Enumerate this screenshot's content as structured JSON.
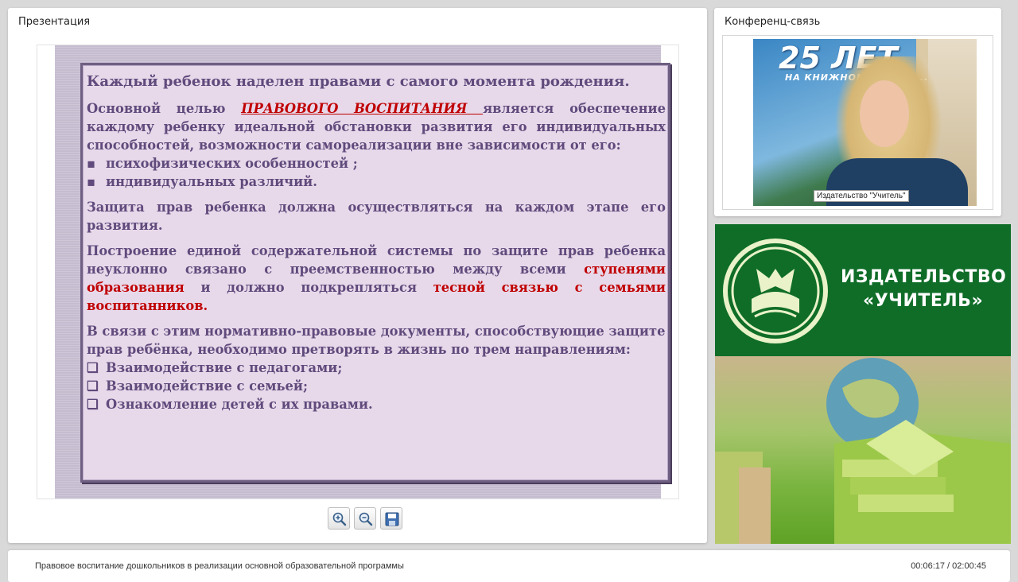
{
  "presentation": {
    "title": "Презентация",
    "slide": {
      "p1": "Каждый ребенок наделен правами с самого момента рождения.",
      "p2_before": "Основной целью ",
      "p2_highlight": "ПРАВОВОГО ВОСПИТАНИЯ ",
      "p2_after": " является обеспечение каждому ребенку идеальной обстановки развития его индивидуальных способностей, возможности самореализации вне зависимости от его:",
      "bullet_marker": "▪",
      "bullets": [
        "психофизических особенностей ;",
        "индивидуальных различий."
      ],
      "p3": "Защита прав ребенка должна осуществляться на каждом этапе его развития.",
      "p4_a": "Построение единой содержательной системы по защите прав ребенка неуклонно связано с преемственностью между всеми ",
      "p4_b": "ступенями образования",
      "p4_c": " и должно подкрепляться ",
      "p4_d": "тесной связью с семьями воспитанников.",
      "p5": "В связи с этим нормативно-правовые документы, способствующие защите прав ребёнка, необходимо претворять в жизнь по трем направлениям:",
      "check_marker": "❑",
      "checks": [
        "Взаимодействие с педагогами;",
        "Взаимодействие с семьей;",
        "Ознакомление детей с их правами."
      ]
    },
    "toolbar": {
      "zoom_in_icon": "zoom-in-icon",
      "zoom_out_icon": "zoom-out-icon",
      "save_icon": "save-icon"
    }
  },
  "conference": {
    "title": "Конференц-связь",
    "video": {
      "banner_big": "25 ЛЕТ",
      "banner_small": "НА КНИЖНОМ Р... РОС...",
      "caption": "Издательство \"Учитель\""
    }
  },
  "publisher": {
    "line1": "ИЗДАТЕЛЬСТВО",
    "line2": "«УЧИТЕЛЬ»",
    "brand_green": "#0f6d28"
  },
  "footer": {
    "doc_title": "Правовое воспитание дошкольников в реализации основной образовательной программы",
    "time": "00:06:17 / 02:00:45"
  }
}
